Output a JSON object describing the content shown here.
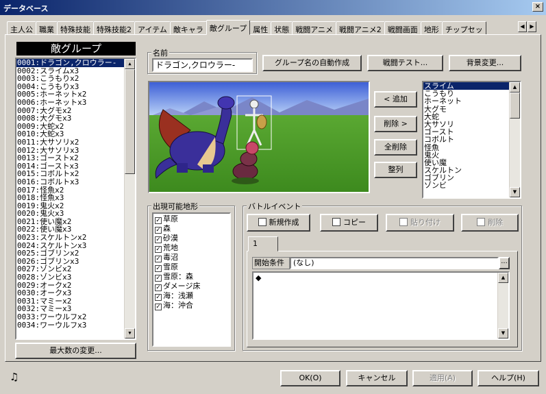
{
  "window": {
    "title": "データベース",
    "close": "×"
  },
  "tabs": [
    "主人公",
    "職業",
    "特殊技能",
    "特殊技能2",
    "アイテム",
    "敵キャラ",
    "敵グループ",
    "属性",
    "状態",
    "戦闘アニメ",
    "戦闘アニメ2",
    "戦闘画面",
    "地形",
    "チップセッ"
  ],
  "tab_scroll": {
    "left": "◀",
    "right": "▶"
  },
  "group_list": {
    "header": "敵グループ",
    "items": [
      "0001:ドラゴン,クロウラー-",
      "0002:スライムx3",
      "0003:こうもりx2",
      "0004:こうもりx3",
      "0005:ホーネットx2",
      "0006:ホーネットx3",
      "0007:大グモx2",
      "0008:大グモx3",
      "0009:大蛇x2",
      "0010:大蛇x3",
      "0011:大サソリx2",
      "0012:大サソリx3",
      "0013:ゴーストx2",
      "0014:ゴーストx3",
      "0015:コボルトx2",
      "0016:コボルトx3",
      "0017:怪魚x2",
      "0018:怪魚x3",
      "0019:鬼火x2",
      "0020:鬼火x3",
      "0021:使い魔x2",
      "0022:使い魔x3",
      "0023:スケルトンx2",
      "0024:スケルトンx3",
      "0025:ゴブリンx2",
      "0026:ゴブリンx3",
      "0027:ゾンビx2",
      "0028:ゾンビx3",
      "0029:オークx2",
      "0030:オークx3",
      "0031:マミーx2",
      "0032:マミーx3",
      "0033:ワーウルフx2",
      "0034:ワーウルフx3"
    ],
    "max_button": "最大数の変更..."
  },
  "name_section": {
    "label": "名前",
    "value": "ドラゴン,クロウラー-",
    "auto_name_button": "グループ名の自動作成",
    "battle_test_button": "戦闘テスト...",
    "background_button": "背景変更..."
  },
  "monster_buttons": {
    "add": "< 追加",
    "remove": "削除 >",
    "remove_all": "全削除",
    "align": "整列"
  },
  "monster_list": [
    "スライム",
    "こうもり",
    "ホーネット",
    "大グモ",
    "大蛇",
    "大サソリ",
    "ゴースト",
    "コボルト",
    "怪魚",
    "鬼火",
    "使い魔",
    "スケルトン",
    "ゴブリン",
    "ゾンビ"
  ],
  "terrain": {
    "label": "出現可能地形",
    "check_mark": "✓",
    "items": [
      "草原",
      "森",
      "砂漠",
      "荒地",
      "毒沼",
      "雪原",
      "雪原：森",
      "ダメージ床",
      "海：浅瀬",
      "海：沖合"
    ]
  },
  "battle_event": {
    "label": "バトルイベント",
    "new_button": "新規作成",
    "copy_button": "コピー",
    "paste_button": "貼り付け",
    "delete_button": "削除",
    "page_tab": "1",
    "condition_label": "開始条件",
    "condition_value": "(なし)",
    "ellipsis": "...",
    "command_marker": "◆"
  },
  "footer": {
    "ok": "OK(O)",
    "cancel": "キャンセル",
    "apply": "適用(A)",
    "help": "ヘルプ(H)",
    "music_icon": "♫"
  },
  "scroll_arrows": {
    "up": "▲",
    "down": "▼"
  }
}
